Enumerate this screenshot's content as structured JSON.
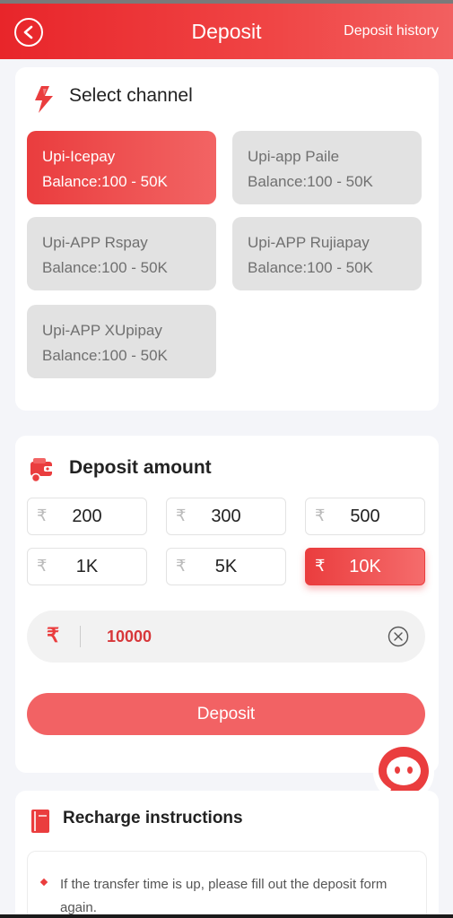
{
  "header": {
    "title": "Deposit",
    "history_label": "Deposit history"
  },
  "channel_section": {
    "title": "Select channel",
    "channels": [
      {
        "name": "Upi-Icepay",
        "balance": "Balance:100 - 50K",
        "selected": true
      },
      {
        "name": "Upi-app Paile",
        "balance": "Balance:100 - 50K",
        "selected": false
      },
      {
        "name": "Upi-APP Rspay",
        "balance": "Balance:100 - 50K",
        "selected": false
      },
      {
        "name": "Upi-APP Rujiapay",
        "balance": "Balance:100 - 50K",
        "selected": false
      },
      {
        "name": "Upi-APP XUpipay",
        "balance": "Balance:100 - 50K",
        "selected": false
      }
    ]
  },
  "amount_section": {
    "title": "Deposit amount",
    "currency_symbol": "₹",
    "presets": [
      {
        "label": "200",
        "selected": false
      },
      {
        "label": "300",
        "selected": false
      },
      {
        "label": "500",
        "selected": false
      },
      {
        "label": "1K",
        "selected": false
      },
      {
        "label": "5K",
        "selected": false
      },
      {
        "label": "10K",
        "selected": true
      }
    ],
    "input_value": "10000",
    "submit_label": "Deposit"
  },
  "instructions": {
    "title": "Recharge instructions",
    "items": [
      "If the transfer time is up, please fill out the deposit form again."
    ]
  },
  "colors": {
    "accent": "#ea3d3e",
    "header": "#e8252a",
    "inactive_channel": "#e2e2e2"
  }
}
